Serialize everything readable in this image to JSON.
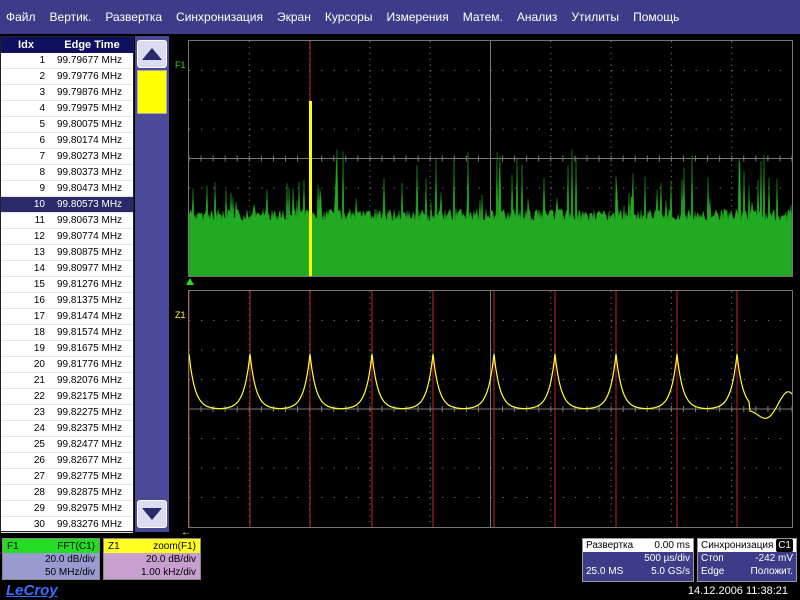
{
  "menu": [
    "Файл",
    "Вертик.",
    "Развертка",
    "Синхронизация",
    "Экран",
    "Курсоры",
    "Измерения",
    "Матем.",
    "Анализ",
    "Утилиты",
    "Помощь"
  ],
  "table": {
    "headers": {
      "idx": "Idx",
      "edge": "Edge Time"
    },
    "rows": [
      {
        "idx": "1",
        "freq": "99.79677 MHz"
      },
      {
        "idx": "2",
        "freq": "99.79776 MHz"
      },
      {
        "idx": "3",
        "freq": "99.79876 MHz"
      },
      {
        "idx": "4",
        "freq": "99.79975 MHz"
      },
      {
        "idx": "5",
        "freq": "99.80075 MHz"
      },
      {
        "idx": "6",
        "freq": "99.80174 MHz"
      },
      {
        "idx": "7",
        "freq": "99.80273 MHz"
      },
      {
        "idx": "8",
        "freq": "99.80373 MHz"
      },
      {
        "idx": "9",
        "freq": "99.80473 MHz"
      },
      {
        "idx": "10",
        "freq": "99.80573 MHz"
      },
      {
        "idx": "11",
        "freq": "99.80673 MHz"
      },
      {
        "idx": "12",
        "freq": "99.80774 MHz"
      },
      {
        "idx": "13",
        "freq": "99.80875 MHz"
      },
      {
        "idx": "14",
        "freq": "99.80977 MHz"
      },
      {
        "idx": "15",
        "freq": "99.81276 MHz"
      },
      {
        "idx": "16",
        "freq": "99.81375 MHz"
      },
      {
        "idx": "17",
        "freq": "99.81474 MHz"
      },
      {
        "idx": "18",
        "freq": "99.81574 MHz"
      },
      {
        "idx": "19",
        "freq": "99.81675 MHz"
      },
      {
        "idx": "20",
        "freq": "99.81776 MHz"
      },
      {
        "idx": "21",
        "freq": "99.82076 MHz"
      },
      {
        "idx": "22",
        "freq": "99.82175 MHz"
      },
      {
        "idx": "23",
        "freq": "99.82275 MHz"
      },
      {
        "idx": "24",
        "freq": "99.82375 MHz"
      },
      {
        "idx": "25",
        "freq": "99.82477 MHz"
      },
      {
        "idx": "26",
        "freq": "99.82677 MHz"
      },
      {
        "idx": "27",
        "freq": "99.82775 MHz"
      },
      {
        "idx": "28",
        "freq": "99.82875 MHz"
      },
      {
        "idx": "29",
        "freq": "99.82975 MHz"
      },
      {
        "idx": "30",
        "freq": "99.83276 MHz"
      }
    ],
    "selected_row": 10
  },
  "trace_labels": {
    "upper": "F1",
    "lower": "Z1"
  },
  "f1": {
    "name": "F1",
    "source": "FFT(C1)",
    "line1": "20.0 dB/div",
    "line2": "50 MHz/div"
  },
  "z1": {
    "name": "Z1",
    "source": "zoom(F1)",
    "line1": "20.0 dB/div",
    "line2": "1.00 kHz/div"
  },
  "timebase": {
    "title": "Развертка",
    "delay": "0.00 ms",
    "per_div": "500 µs/div",
    "samples": "25.0 MS",
    "rate": "5.0 GS/s"
  },
  "trigger": {
    "title": "Синхронизация",
    "channel": "C1",
    "mode": "Стоп",
    "level": "-242 mV",
    "type": "Edge",
    "slope": "Положит."
  },
  "brand": "LeCroy",
  "datetime": "14.12.2006 11:38:21",
  "colors": {
    "menu_bg": "#3c3c88",
    "grid": "#7a7a7a",
    "fft_trace": "#22aa22",
    "zoom_trace": "#ffff33",
    "marker": "#cc2222",
    "selection": "#ffff00"
  },
  "icons": {
    "scroll_up": "triangle-up-icon",
    "scroll_down": "triangle-down-icon"
  }
}
